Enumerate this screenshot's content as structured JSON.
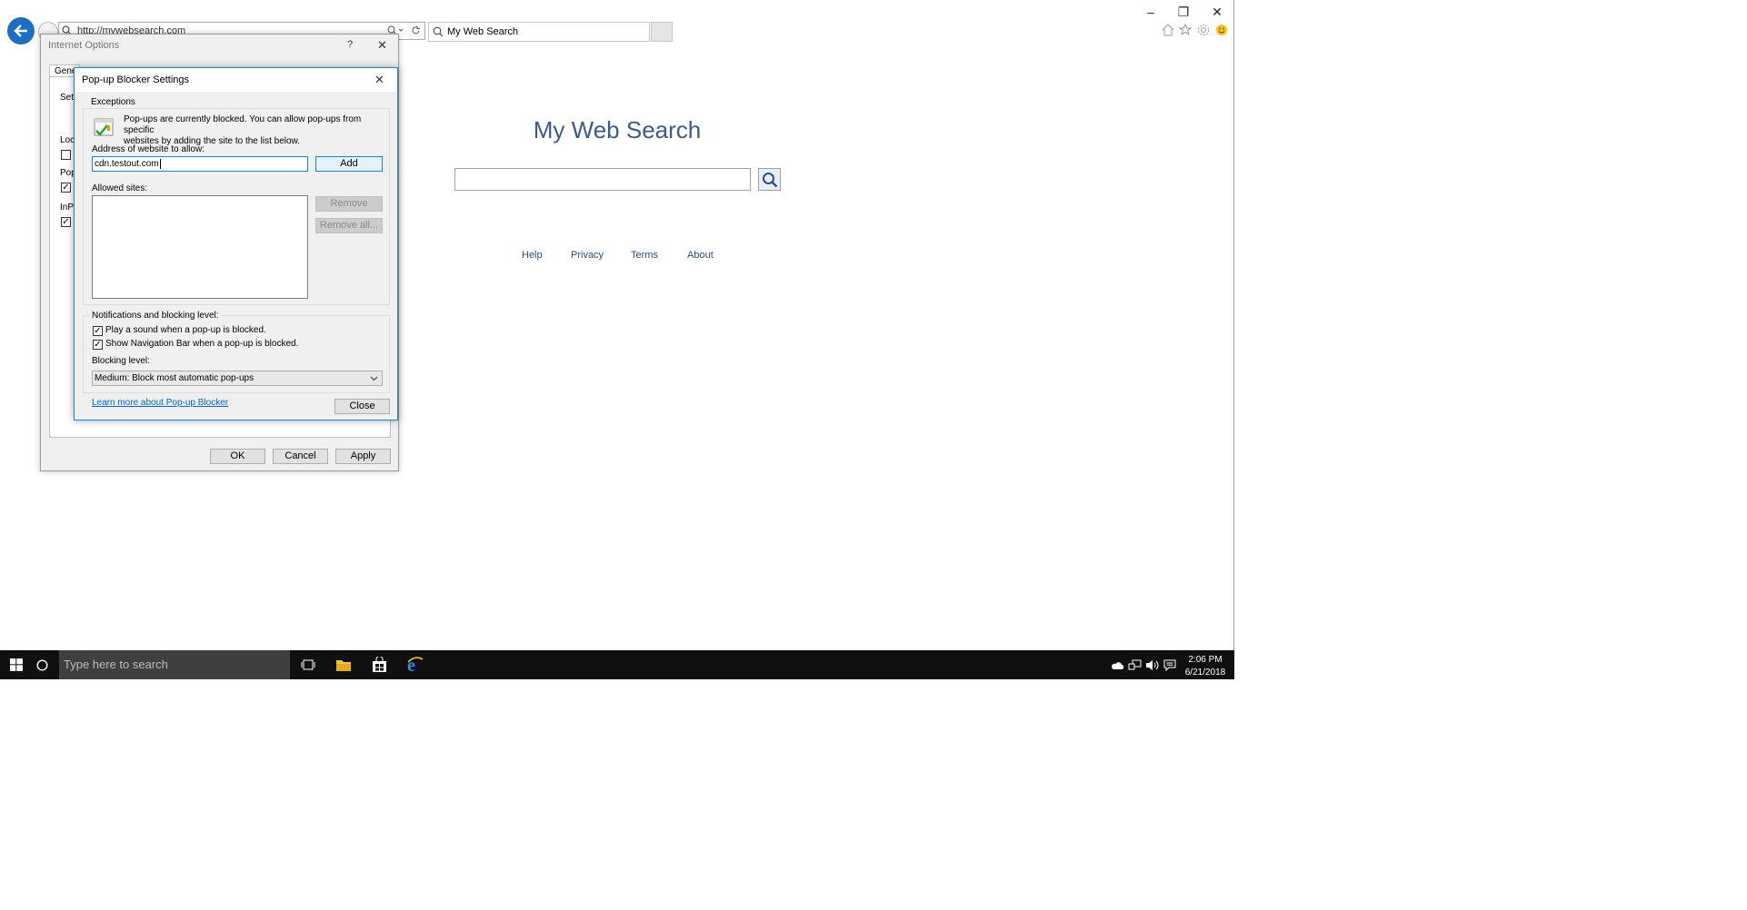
{
  "browser": {
    "address_url": "http://mywebsearch.com",
    "search_tab_label": "My Web Search",
    "window_controls": {
      "minimize": "–",
      "restore": "❐",
      "close": "✕"
    }
  },
  "page": {
    "title": "My Web Search",
    "links": [
      "Help",
      "Privacy",
      "Terms",
      "About"
    ]
  },
  "internet_options": {
    "title": "Internet Options",
    "help_glyph": "?",
    "close_glyph": "✕",
    "tab_partial": "Gene",
    "side_labels": [
      "Sett",
      "Loca",
      "Pop",
      "InPr"
    ],
    "checkbox_states": [
      false,
      true,
      true
    ],
    "buttons": {
      "ok": "OK",
      "cancel": "Cancel",
      "apply": "Apply"
    }
  },
  "popup_blocker": {
    "title": "Pop-up Blocker Settings",
    "close_glyph": "✕",
    "exceptions_label": "Exceptions",
    "info_line1": "Pop-ups are currently blocked. You can allow pop-ups from specific",
    "info_line2": "websites by adding the site to the list below.",
    "address_label": "Address of website to allow:",
    "address_value": "cdn.testout.com",
    "add_button": "Add",
    "allowed_sites_label": "Allowed sites:",
    "allowed_sites": [],
    "remove_button": "Remove",
    "remove_all_button": "Remove all...",
    "notifications_label": "Notifications and blocking level:",
    "play_sound_label": "Play a sound when a pop-up is blocked.",
    "play_sound_checked": true,
    "show_navbar_label": "Show Navigation Bar when a pop-up is blocked.",
    "show_navbar_checked": true,
    "blocking_level_label": "Blocking level:",
    "blocking_level_value": "Medium: Block most automatic pop-ups",
    "learn_more_link": "Learn more about Pop-up Blocker",
    "close_button": "Close"
  },
  "taskbar": {
    "search_placeholder": "Type here to search",
    "time": "2:06 PM",
    "date": "6/21/2018"
  },
  "colors": {
    "accent": "#1883d7",
    "back_button": "#1b6ec2",
    "page_title": "#3c5a8a",
    "link": "#2a4f80",
    "taskbar": "#101010"
  }
}
